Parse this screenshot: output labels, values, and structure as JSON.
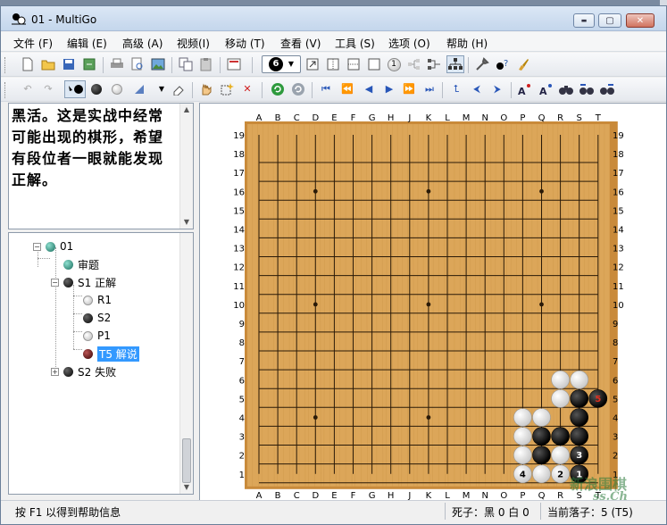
{
  "window": {
    "title": "01 - MultiGo",
    "controls": {
      "minimize": "▬",
      "maximize": "▢",
      "close": "✕"
    }
  },
  "menu": [
    {
      "id": "file",
      "label": "文件 (F)"
    },
    {
      "id": "edit",
      "label": "编辑 (E)"
    },
    {
      "id": "advanced",
      "label": "高级 (A)"
    },
    {
      "id": "view",
      "label": "视频(I)"
    },
    {
      "id": "move",
      "label": "移动 (T)"
    },
    {
      "id": "search",
      "label": "查看 (V)"
    },
    {
      "id": "tools",
      "label": "工具 (S)"
    },
    {
      "id": "options",
      "label": "选项 (O)"
    },
    {
      "id": "help",
      "label": "帮助 (H)"
    }
  ],
  "toolbar": {
    "move_number": "6",
    "numbered_stone": "1"
  },
  "comment": {
    "text": "黑活。这是实战中经常可能出现的棋形，希望有段位者一眼就能发现正解。"
  },
  "tree": {
    "nodes": [
      {
        "id": "root",
        "label": "01",
        "stone": "green"
      },
      {
        "id": "problem",
        "label": "审题",
        "stone": "green"
      },
      {
        "id": "s1",
        "label": "S1 正解",
        "stone": "black"
      },
      {
        "id": "r1",
        "label": "R1",
        "stone": "white"
      },
      {
        "id": "s2a",
        "label": "S2",
        "stone": "black"
      },
      {
        "id": "p1",
        "label": "P1",
        "stone": "white"
      },
      {
        "id": "t5",
        "label": "T5 解说",
        "stone": "red",
        "selected": true
      },
      {
        "id": "s2b",
        "label": "S2 失败",
        "stone": "black"
      }
    ],
    "expanders": {
      "open": "−",
      "closed": "+"
    }
  },
  "board": {
    "size": 19,
    "columns": [
      "A",
      "B",
      "C",
      "D",
      "E",
      "F",
      "G",
      "H",
      "J",
      "K",
      "L",
      "M",
      "N",
      "O",
      "P",
      "Q",
      "R",
      "S",
      "T"
    ],
    "rows": [
      19,
      18,
      17,
      16,
      15,
      14,
      13,
      12,
      11,
      10,
      9,
      8,
      7,
      6,
      5,
      4,
      3,
      2,
      1
    ],
    "hoshi": [
      [
        "D",
        16
      ],
      [
        "K",
        16
      ],
      [
        "Q",
        16
      ],
      [
        "D",
        10
      ],
      [
        "K",
        10
      ],
      [
        "Q",
        10
      ],
      [
        "D",
        4
      ],
      [
        "K",
        4
      ],
      [
        "Q",
        4
      ]
    ],
    "stones": [
      {
        "col": "R",
        "row": 6,
        "color": "white"
      },
      {
        "col": "S",
        "row": 6,
        "color": "white"
      },
      {
        "col": "R",
        "row": 5,
        "color": "white"
      },
      {
        "col": "S",
        "row": 5,
        "color": "black"
      },
      {
        "col": "T",
        "row": 5,
        "color": "black",
        "label": "5",
        "labelColor": "#e03020"
      },
      {
        "col": "P",
        "row": 4,
        "color": "white"
      },
      {
        "col": "Q",
        "row": 4,
        "color": "white"
      },
      {
        "col": "S",
        "row": 4,
        "color": "black"
      },
      {
        "col": "P",
        "row": 3,
        "color": "white"
      },
      {
        "col": "Q",
        "row": 3,
        "color": "black"
      },
      {
        "col": "R",
        "row": 3,
        "color": "black"
      },
      {
        "col": "S",
        "row": 3,
        "color": "black"
      },
      {
        "col": "P",
        "row": 2,
        "color": "white"
      },
      {
        "col": "Q",
        "row": 2,
        "color": "black"
      },
      {
        "col": "R",
        "row": 2,
        "color": "white"
      },
      {
        "col": "S",
        "row": 2,
        "color": "black",
        "label": "3",
        "labelColor": "#ffffff"
      },
      {
        "col": "P",
        "row": 1,
        "color": "white",
        "label": "4",
        "labelColor": "#000000"
      },
      {
        "col": "Q",
        "row": 1,
        "color": "white"
      },
      {
        "col": "R",
        "row": 1,
        "color": "white",
        "label": "2",
        "labelColor": "#000000"
      },
      {
        "col": "S",
        "row": 1,
        "color": "black",
        "label": "1",
        "labelColor": "#ffffff"
      }
    ],
    "colors": {
      "wood": "#dca659",
      "border": "#c98a3a",
      "line": "#2a1a08"
    }
  },
  "status": {
    "help": "按 F1 以得到帮助信息",
    "captures": "死子：黑 0 白 0",
    "current_move": "当前落子：5 (T5)"
  },
  "watermark": {
    "text": "新浪围棋",
    "sub": "ss.Ch"
  }
}
